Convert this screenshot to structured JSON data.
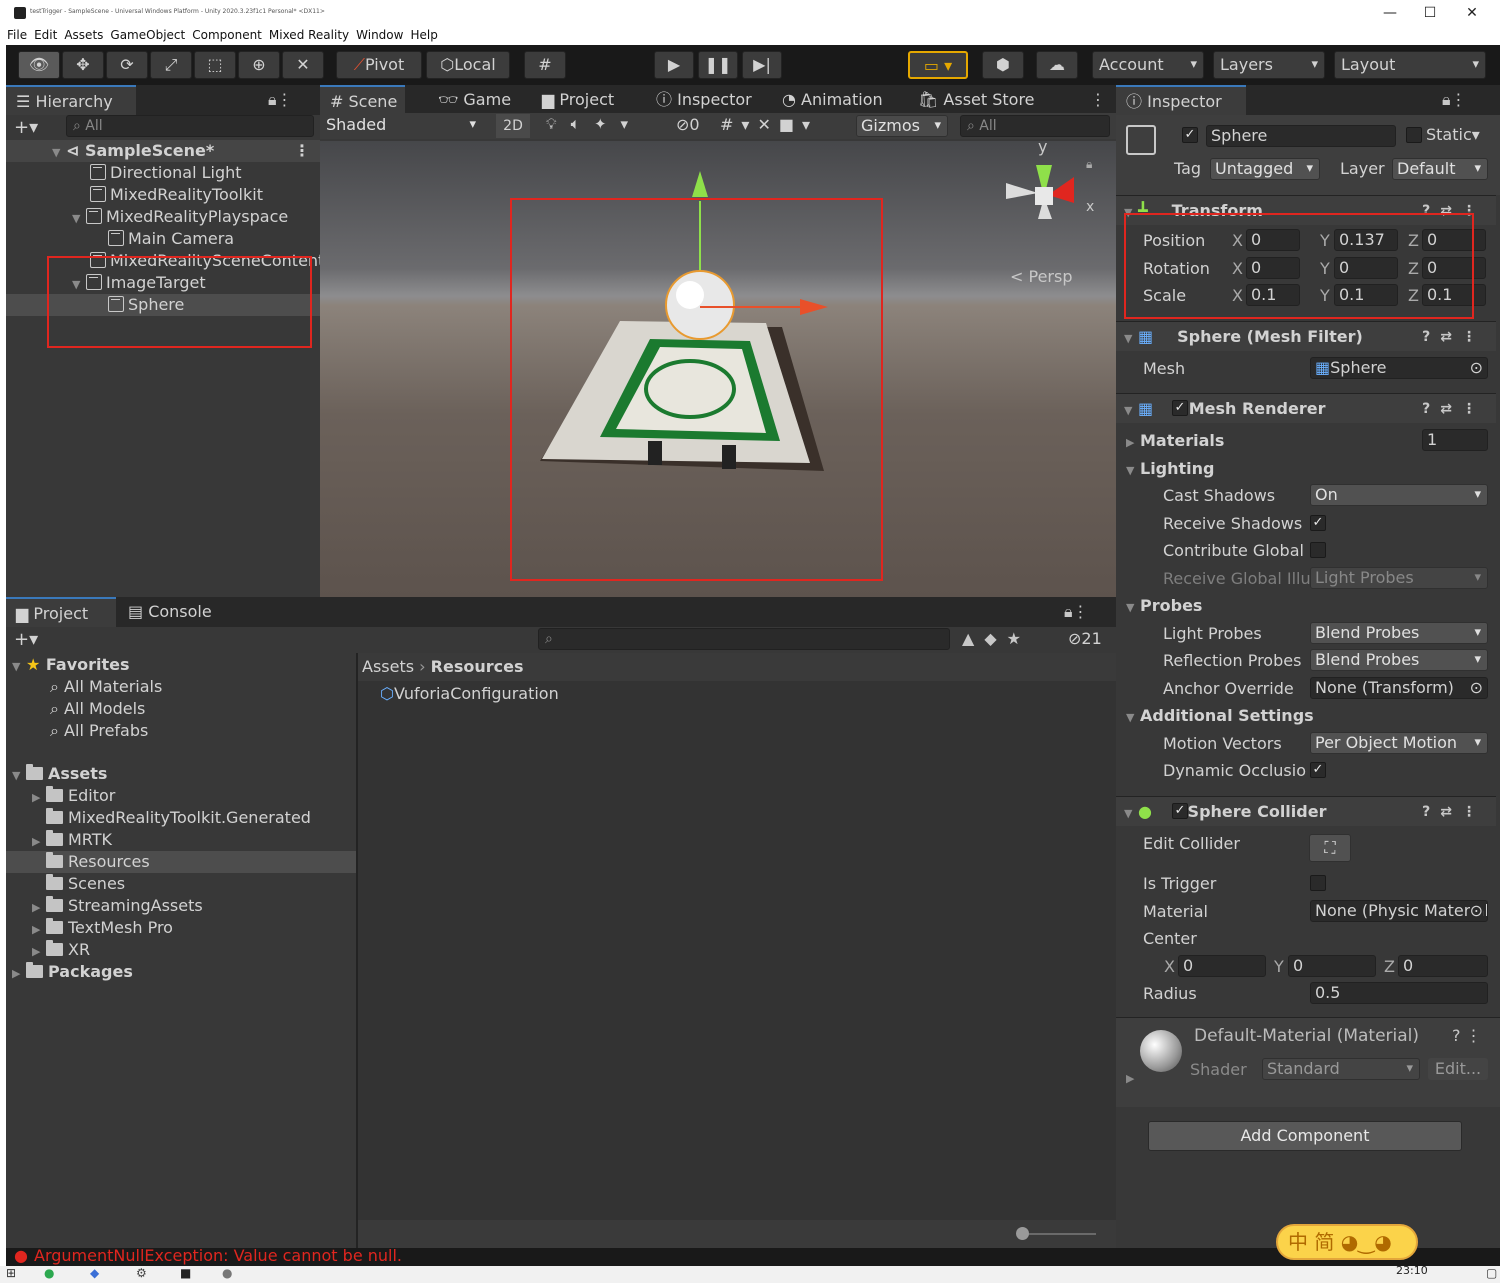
{
  "window": {
    "title": "testTrigger - SampleScene - Universal Windows Platform - Unity 2020.3.23f1c1 Personal* <DX11>"
  },
  "menu": [
    "File",
    "Edit",
    "Assets",
    "GameObject",
    "Component",
    "Mixed Reality",
    "Window",
    "Help"
  ],
  "toolbar": {
    "pivot": "Pivot",
    "local": "Local",
    "account": "Account",
    "layers": "Layers",
    "layout": "Layout"
  },
  "hierarchy": {
    "tab": "Hierarchy",
    "search_placeholder": "All",
    "scene": "SampleScene*",
    "items": [
      "Directional Light",
      "MixedRealityToolkit",
      "MixedRealityPlayspace",
      "Main Camera",
      "MixedRealitySceneContent",
      "ImageTarget",
      "Sphere"
    ]
  },
  "scene_tabs": [
    "Scene",
    "Game",
    "Project",
    "Inspector",
    "Animation",
    "Asset Store"
  ],
  "scene_toolbar": {
    "shading": "Shaded",
    "mode2d": "2D",
    "hidden_count": "0",
    "gizmos": "Gizmos",
    "search": "All",
    "persp": "< Persp",
    "axis_y": "y",
    "axis_x": "x"
  },
  "project": {
    "tabs": [
      "Project",
      "Console"
    ],
    "hidden_count": "21",
    "breadcrumb": [
      "Assets",
      "Resources"
    ],
    "favorites_label": "Favorites",
    "favorites": [
      "All Materials",
      "All Models",
      "All Prefabs"
    ],
    "assets_label": "Assets",
    "folders": [
      "Editor",
      "MixedRealityToolkit.Generated",
      "MRTK",
      "Resources",
      "Scenes",
      "StreamingAssets",
      "TextMesh Pro",
      "XR"
    ],
    "packages_label": "Packages",
    "files": [
      "VuforiaConfiguration"
    ]
  },
  "status": {
    "error": "ArgumentNullException: Value cannot be null."
  },
  "inspector": {
    "tab": "Inspector",
    "name": "Sphere",
    "static": "Static",
    "tag_label": "Tag",
    "tag": "Untagged",
    "layer_label": "Layer",
    "layer": "Default",
    "transform": {
      "title": "Transform",
      "position_label": "Position",
      "rotation_label": "Rotation",
      "scale_label": "Scale",
      "position": [
        "0",
        "0.137",
        "0"
      ],
      "rotation": [
        "0",
        "0",
        "0"
      ],
      "scale": [
        "0.1",
        "0.1",
        "0.1"
      ]
    },
    "mesh_filter": {
      "title": "Sphere (Mesh Filter)",
      "mesh_label": "Mesh",
      "mesh": "Sphere"
    },
    "mesh_renderer": {
      "title": "Mesh Renderer",
      "materials_label": "Materials",
      "materials_count": "1",
      "lighting_label": "Lighting",
      "cast_shadows_label": "Cast Shadows",
      "cast_shadows": "On",
      "receive_shadows_label": "Receive Shadows",
      "contribute_gi_label": "Contribute Global I",
      "receive_gi_label": "Receive Global Illu",
      "receive_gi": "Light Probes",
      "probes_label": "Probes",
      "light_probes_label": "Light Probes",
      "light_probes": "Blend Probes",
      "reflection_probes_label": "Reflection Probes",
      "reflection_probes": "Blend Probes",
      "anchor_label": "Anchor Override",
      "anchor": "None (Transform)",
      "additional_label": "Additional Settings",
      "motion_label": "Motion Vectors",
      "motion": "Per Object Motion",
      "occlusion_label": "Dynamic Occlusion"
    },
    "sphere_collider": {
      "title": "Sphere Collider",
      "edit_label": "Edit Collider",
      "trigger_label": "Is Trigger",
      "material_label": "Material",
      "material": "None (Physic Material)",
      "center_label": "Center",
      "center": [
        "0",
        "0",
        "0"
      ],
      "radius_label": "Radius",
      "radius": "0.5"
    },
    "material": {
      "title": "Default-Material (Material)",
      "shader_label": "Shader",
      "shader": "Standard",
      "edit": "Edit..."
    },
    "add_component": "Add Component"
  },
  "taskbar": {
    "time": "23:10",
    "ime": "中 简"
  }
}
